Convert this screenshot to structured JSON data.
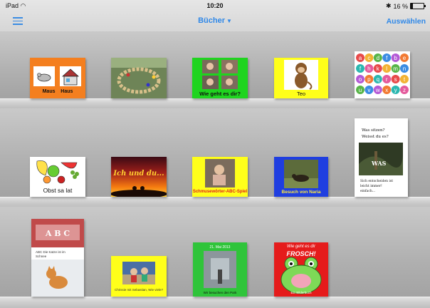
{
  "status": {
    "device": "iPad",
    "time": "10:20",
    "battery_text": "16 %",
    "battery_level": 0.16
  },
  "nav": {
    "title": "Bücher",
    "right_label": "Auswählen"
  },
  "books": [
    {
      "caption_left": "Maus",
      "caption_right": "Haus"
    },
    {
      "caption": ""
    },
    {
      "caption": "Wie geht es dir?"
    },
    {
      "caption": "Teo"
    },
    {
      "letters": [
        "a",
        "c",
        "d",
        "f",
        "b",
        "e",
        "f",
        "h",
        "k",
        "l",
        "m",
        "n",
        "o",
        "p",
        "q",
        "r",
        "s",
        "t",
        "u",
        "v",
        "w",
        "x",
        "y",
        "z"
      ]
    },
    {
      "caption": "Obst sa lat"
    },
    {
      "caption": "Ich und du..."
    },
    {
      "caption": "Schmusewörter-ABC-Spiel"
    },
    {
      "caption": "Besuch von Naria"
    },
    {
      "line1": "Was sitzen?",
      "line2": "Weisst du es?",
      "overlay": "WAS",
      "text1": "Sich entscheiden ist",
      "text2": "leicht immer!",
      "text3": "einfach..."
    },
    {
      "banner": "A B C",
      "line": "ABC Die Katze ist im",
      "line2": "Schnee"
    },
    {
      "caption": "Chrissie mit Sebastian, Wie viele?"
    },
    {
      "top": "21. Mai 2013",
      "caption": "Wir besuchen den Park"
    },
    {
      "title1": "Wie geht es dir",
      "title2": "FROSCH!",
      "author": "Ein Bilderbuch"
    }
  ]
}
